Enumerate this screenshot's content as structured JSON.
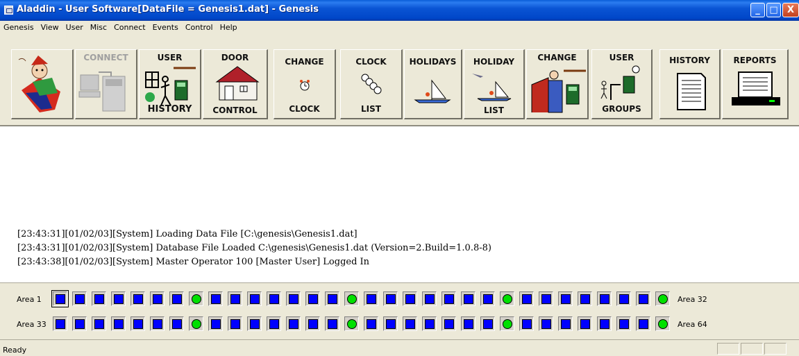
{
  "window": {
    "title": "Aladdin - User Software[DataFile = Genesis1.dat] - Genesis"
  },
  "title_buttons": [
    "_",
    "□",
    "X"
  ],
  "menu": [
    "Genesis",
    "View",
    "User",
    "Misc",
    "Connect",
    "Events",
    "Control",
    "Help"
  ],
  "toolbar": {
    "connect": "CONNECT",
    "user_history": {
      "top": "USER",
      "bottom": "HISTORY"
    },
    "door_control": {
      "top": "DOOR",
      "bottom": "CONTROL"
    },
    "change_clock": {
      "top": "CHANGE",
      "bottom": "CLOCK"
    },
    "clock_list": {
      "top": "CLOCK",
      "bottom": "LIST"
    },
    "holidays": "HOLIDAYS",
    "holiday_list": {
      "top": "HOLIDAY",
      "bottom": "LIST"
    },
    "change": "CHANGE",
    "user_groups": {
      "top": "USER",
      "bottom": "GROUPS"
    },
    "history": "HISTORY",
    "reports": "REPORTS"
  },
  "log": [
    "[23:43:31][01/02/03][System] Loading Data File [C:\\genesis\\Genesis1.dat]",
    "[23:43:31][01/02/03][System] Database File Loaded C:\\genesis\\Genesis1.dat (Version=2.Build=1.0.8-8)",
    "[23:43:38][01/02/03][System] Master Operator 100 [Master User] Logged In"
  ],
  "areas": {
    "row1_start": "Area 1",
    "row1_end": "Area 32",
    "row2_start": "Area 33",
    "row2_end": "Area 64",
    "colors": {
      "armed": "#0000ff",
      "ok": "#00e000"
    },
    "row1_states": [
      "blue",
      "blue",
      "blue",
      "blue",
      "blue",
      "blue",
      "blue",
      "green",
      "blue",
      "blue",
      "blue",
      "blue",
      "blue",
      "blue",
      "blue",
      "green",
      "blue",
      "blue",
      "blue",
      "blue",
      "blue",
      "blue",
      "blue",
      "green",
      "blue",
      "blue",
      "blue",
      "blue",
      "blue",
      "blue",
      "blue",
      "green"
    ],
    "row2_states": [
      "blue",
      "blue",
      "blue",
      "blue",
      "blue",
      "blue",
      "blue",
      "green",
      "blue",
      "blue",
      "blue",
      "blue",
      "blue",
      "blue",
      "blue",
      "green",
      "blue",
      "blue",
      "blue",
      "blue",
      "blue",
      "blue",
      "blue",
      "green",
      "blue",
      "blue",
      "blue",
      "blue",
      "blue",
      "blue",
      "blue",
      "green"
    ]
  },
  "status": {
    "text": "Ready"
  }
}
